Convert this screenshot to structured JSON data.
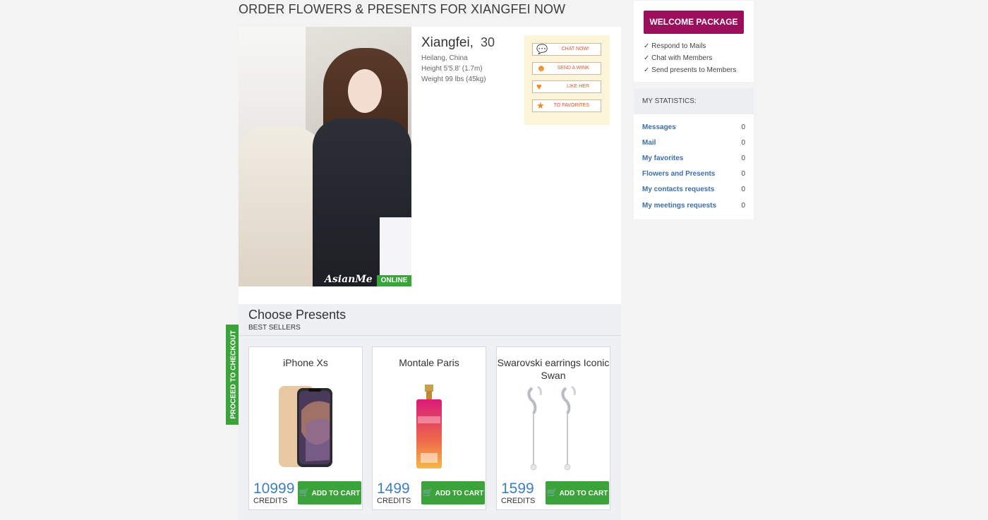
{
  "page": {
    "title": "ORDER FLOWERS & PRESENTS FOR XIANGFEI NOW"
  },
  "profile": {
    "name": "Xiangfei,",
    "age": "30",
    "location": "Heilang, China",
    "height": "Height 5'5.8' (1.7m)",
    "weight": "Weight 99 lbs (45kg)",
    "online_badge": "ONLINE",
    "watermark": "AsianMe",
    "actions": [
      {
        "label": "CHAT NOW!",
        "icon": "chat-bubble-icon"
      },
      {
        "label": "SEND A WINK",
        "icon": "smiley-icon"
      },
      {
        "label": "LIKE HER",
        "icon": "heart-icon"
      },
      {
        "label": "TO FAVORITES",
        "icon": "star-icon"
      }
    ]
  },
  "presents": {
    "title": "Choose Presents",
    "subtitle": "BEST SELLERS",
    "checkout_label": "PROCEED TO CHECKOUT",
    "credits_label": "CREDITS",
    "add_to_cart_label": "ADD TO CART",
    "items": [
      {
        "name": "iPhone Xs",
        "price": "10999",
        "image": "phone-image"
      },
      {
        "name": "Montale Paris",
        "price": "1499",
        "image": "perfume-image"
      },
      {
        "name": "Swarovski earrings Iconic Swan",
        "price": "1599",
        "image": "earrings-image"
      }
    ]
  },
  "welcome": {
    "button_label": "WELCOME PACKAGE",
    "items": [
      "✓ Respond to Mails",
      "✓ Chat with Members",
      "✓ Send presents to Members"
    ]
  },
  "stats": {
    "title": "MY STATISTICS:",
    "rows": [
      {
        "label": "Messages",
        "value": "0"
      },
      {
        "label": "Mail",
        "value": "0"
      },
      {
        "label": "My favorites",
        "value": "0"
      },
      {
        "label": "Flowers and Presents",
        "value": "0"
      },
      {
        "label": "My contacts requests",
        "value": "0"
      },
      {
        "label": "My meetings requests",
        "value": "0"
      }
    ]
  },
  "colors": {
    "accent_green": "#3aa33a",
    "welcome_magenta": "#9b0f5c",
    "price_blue": "#3d7fc3",
    "link_blue": "#3d6ea8",
    "action_orange": "#e8562a"
  }
}
